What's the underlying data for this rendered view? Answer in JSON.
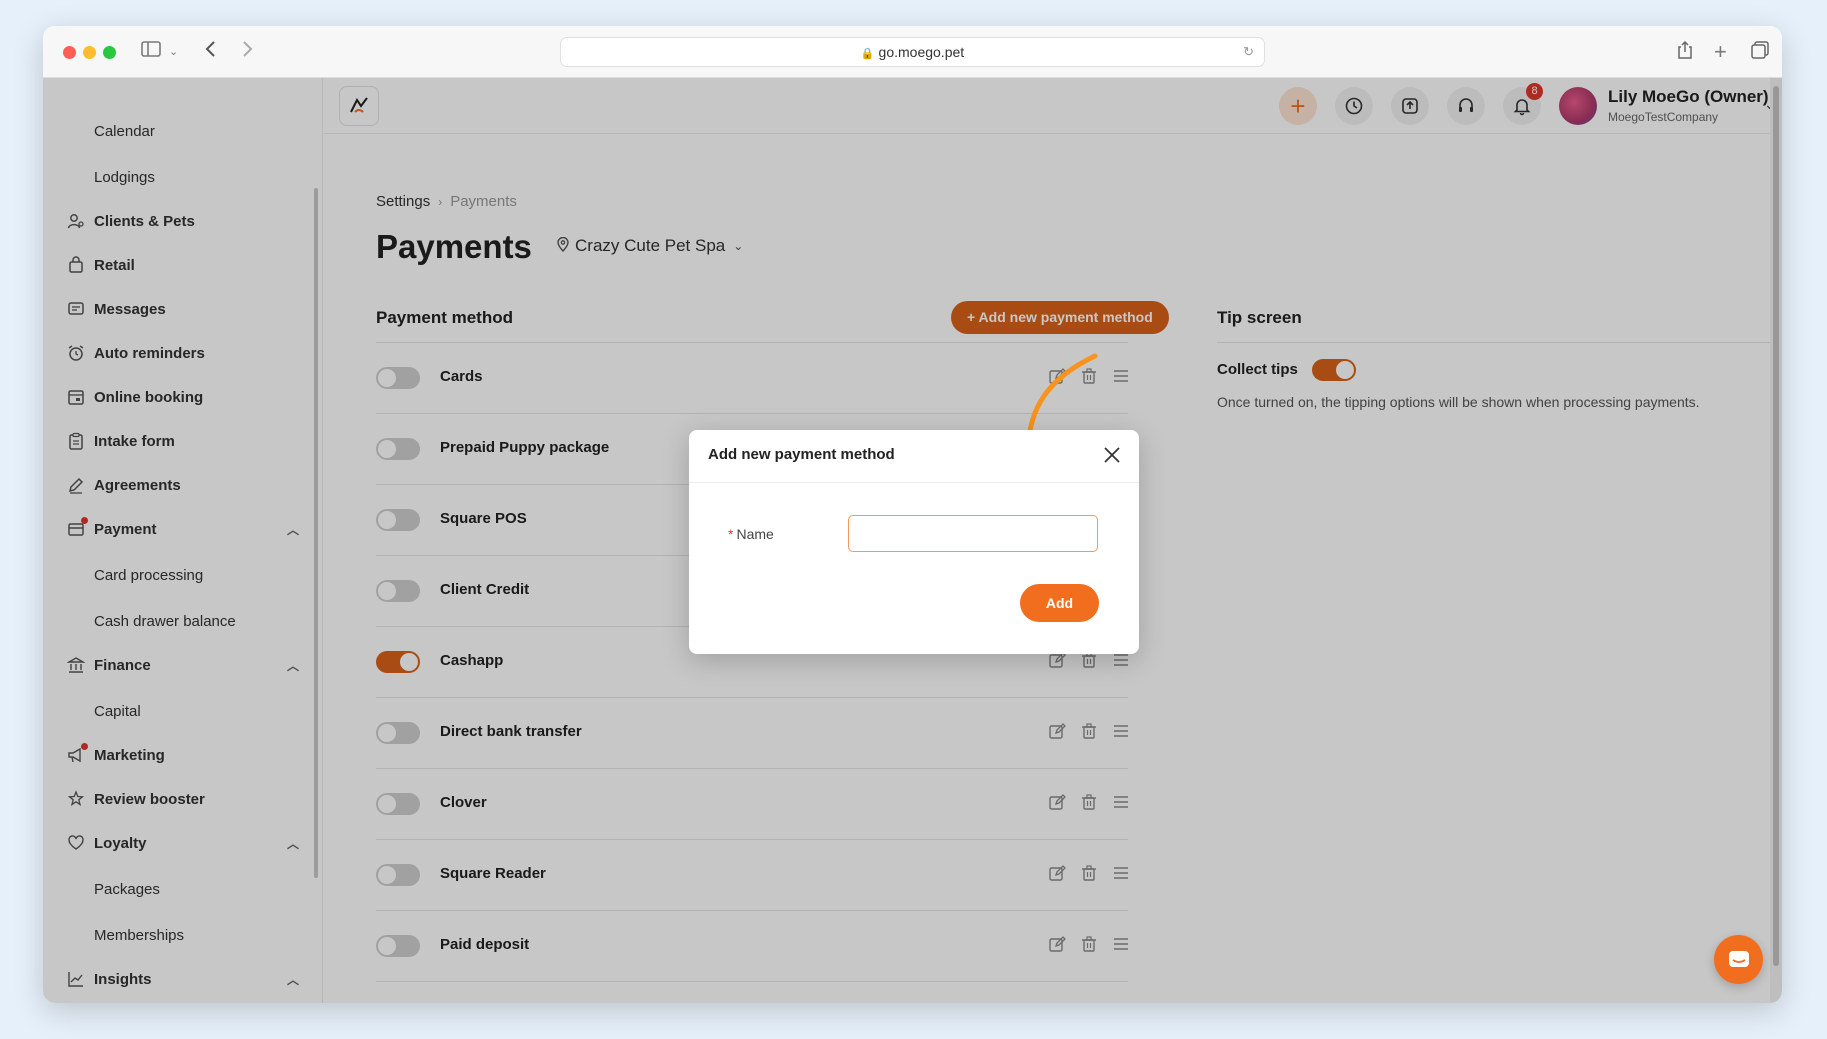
{
  "browser": {
    "url": "go.moego.pet"
  },
  "sidebar": {
    "items": [
      {
        "label": "Calendar",
        "type": "sub"
      },
      {
        "label": "Lodgings",
        "type": "sub"
      },
      {
        "label": "Clients & Pets",
        "icon": "clients-icon"
      },
      {
        "label": "Retail",
        "icon": "retail-icon"
      },
      {
        "label": "Messages",
        "icon": "messages-icon"
      },
      {
        "label": "Auto reminders",
        "icon": "alarm-clock-icon"
      },
      {
        "label": "Online booking",
        "icon": "online-booking-icon"
      },
      {
        "label": "Intake form",
        "icon": "clipboard-icon"
      },
      {
        "label": "Agreements",
        "icon": "pen-icon"
      },
      {
        "label": "Payment",
        "icon": "payment-icon"
      },
      {
        "label": "Card processing",
        "type": "sub"
      },
      {
        "label": "Cash drawer balance",
        "type": "sub"
      },
      {
        "label": "Finance",
        "icon": "bank-icon"
      },
      {
        "label": "Capital",
        "type": "sub"
      },
      {
        "label": "Marketing",
        "icon": "megaphone-icon"
      },
      {
        "label": "Review booster",
        "icon": "review-icon"
      },
      {
        "label": "Loyalty",
        "icon": "loyalty-icon"
      },
      {
        "label": "Packages",
        "type": "sub"
      },
      {
        "label": "Memberships",
        "type": "sub"
      },
      {
        "label": "Insights",
        "icon": "chart-icon"
      }
    ]
  },
  "topbar": {
    "notification_count": "8",
    "user_name": "Lily MoeGo (Owner)",
    "company": "MoegoTestCompany"
  },
  "breadcrumb": {
    "root": "Settings",
    "current": "Payments"
  },
  "page": {
    "title": "Payments",
    "location": "Crazy Cute Pet Spa"
  },
  "payment_methods": {
    "title": "Payment method",
    "add_button": "+ Add new payment method",
    "rows": [
      {
        "name": "Cards",
        "enabled": false
      },
      {
        "name": "Prepaid Puppy package",
        "enabled": false
      },
      {
        "name": "Square POS",
        "enabled": false
      },
      {
        "name": "Client Credit",
        "enabled": false
      },
      {
        "name": "Cashapp",
        "enabled": true
      },
      {
        "name": "Direct bank transfer",
        "enabled": false
      },
      {
        "name": "Clover",
        "enabled": false
      },
      {
        "name": "Square Reader",
        "enabled": false
      },
      {
        "name": "Paid deposit",
        "enabled": false
      }
    ]
  },
  "tip_screen": {
    "title": "Tip screen",
    "collect_label": "Collect tips",
    "collect_enabled": true,
    "description": "Once turned on, the tipping options will be shown when processing payments."
  },
  "modal": {
    "title": "Add new payment method",
    "name_label": "Name",
    "name_value": "",
    "add_label": "Add"
  },
  "colors": {
    "accent": "#f26e1f",
    "accent_dark": "#d9621a",
    "annotation_arrow": "#f7931e"
  }
}
